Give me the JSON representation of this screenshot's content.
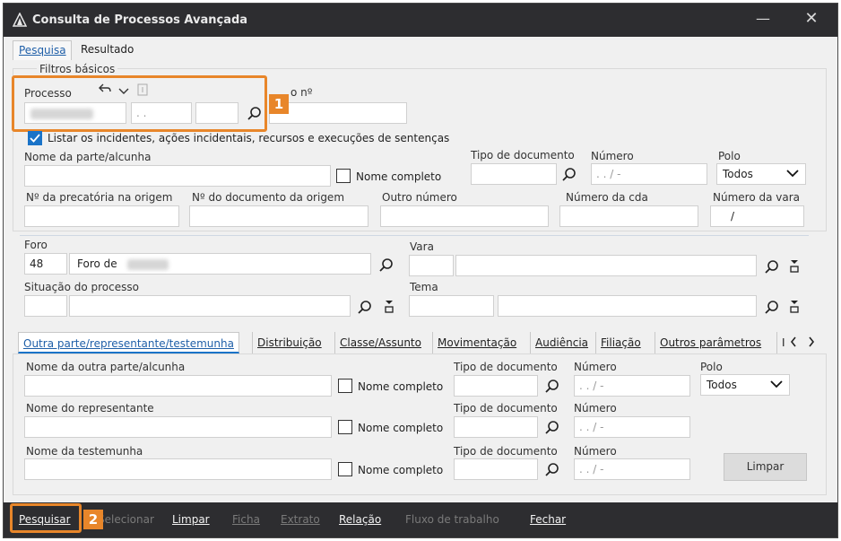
{
  "window": {
    "title": "Consulta de Processos Avançada",
    "minimize": "—",
    "close": "✕"
  },
  "main_tabs": [
    "Pesquisa",
    "Resultado"
  ],
  "filtros": {
    "group_title": "Filtros básicos",
    "processo_label": "Processo",
    "processo_part2": ". .",
    "outro_no_label": "o nº",
    "listar_label": "Listar os incidentes, ações incidentais, recursos e execuções de sentenças",
    "nome_parte_label": "Nome da parte/alcunha",
    "nome_completo": "Nome completo",
    "tipo_documento_label": "Tipo de documento",
    "numero_label": "Número",
    "numero_placeholder": ". .  /  -",
    "polo_label": "Polo",
    "polo_value": "Todos",
    "precatoria_label": "Nº da precatória na origem",
    "doc_origem_label": "Nº do documento da origem",
    "outro_numero_label": "Outro número",
    "numero_cda_label": "Número da cda",
    "numero_vara_label": "Número da vara",
    "numero_vara_value": "/"
  },
  "foro": {
    "foro_label": "Foro",
    "foro_code": "48",
    "foro_name": "Foro de",
    "vara_label": "Vara",
    "situacao_label": "Situação do processo",
    "tema_label": "Tema"
  },
  "sub_tabs": [
    "Outra parte/representante/testemunha",
    "Distribuição",
    "Classe/Assunto",
    "Movimentação",
    "Audiência",
    "Filiação",
    "Outros parâmetros",
    "I"
  ],
  "outra_parte": {
    "nome_outra_label": "Nome da outra parte/alcunha",
    "nome_rep_label": "Nome do representante",
    "nome_test_label": "Nome da testemunha",
    "nome_completo": "Nome completo",
    "tipo_documento_label": "Tipo de documento",
    "numero_label": "Número",
    "numero_placeholder": ". .  /  -",
    "polo_label": "Polo",
    "polo_value": "Todos",
    "limpar": "Limpar"
  },
  "bottom_bar": [
    "Pesquisar",
    "Selecionar",
    "Limpar",
    "Ficha",
    "Extrato",
    "Relação",
    "Fluxo de trabalho",
    "Fechar"
  ],
  "callouts": [
    "1",
    "2"
  ],
  "colors": {
    "accent": "#1a73c8",
    "callout": "#e8862a",
    "titlebar": "#2d2d30"
  },
  "icons": [
    "app-logo-icon",
    "undo-icon",
    "chevron-down-icon",
    "bookmark-icon",
    "search-icon",
    "clear-filter-icon",
    "scroll-left-icon",
    "scroll-right-icon"
  ]
}
